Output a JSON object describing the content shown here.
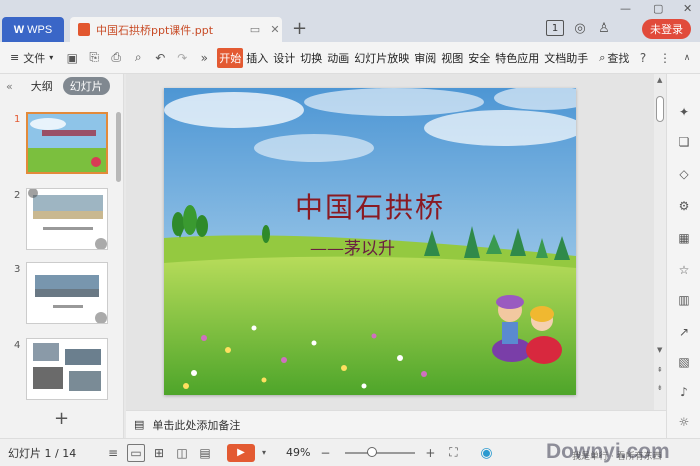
{
  "titlebar": {
    "wps_tab": "WPS",
    "doc_tab": "中国石拱桥ppt课件.ppt",
    "slide_count_badge": "1",
    "login_button": "未登录"
  },
  "toolbar": {
    "file_menu": "文件",
    "ribbon_tabs": [
      "开始",
      "插入",
      "设计",
      "切换",
      "动画",
      "幻灯片放映",
      "审阅",
      "视图",
      "安全",
      "特色应用",
      "文档助手"
    ],
    "active_tab": "开始",
    "search_label": "查找"
  },
  "left_panel": {
    "tab_outline": "大纲",
    "tab_slides": "幻灯片",
    "thumb_numbers": [
      "1",
      "2",
      "3",
      "4"
    ]
  },
  "slide": {
    "title": "中国石拱桥",
    "author": "——茅以升"
  },
  "notes": {
    "placeholder": "单击此处添加备注"
  },
  "statusbar": {
    "slide_indicator": "幻灯片 1 / 14",
    "zoom": "49%"
  },
  "watermark": {
    "text": "Downyi.com",
    "subtext": "我是单行 · 看所有东西"
  },
  "colors": {
    "accent": "#e35a32",
    "wps_blue": "#3a66c7",
    "login_red": "#e14b3b",
    "title_red": "#8a1a22"
  }
}
